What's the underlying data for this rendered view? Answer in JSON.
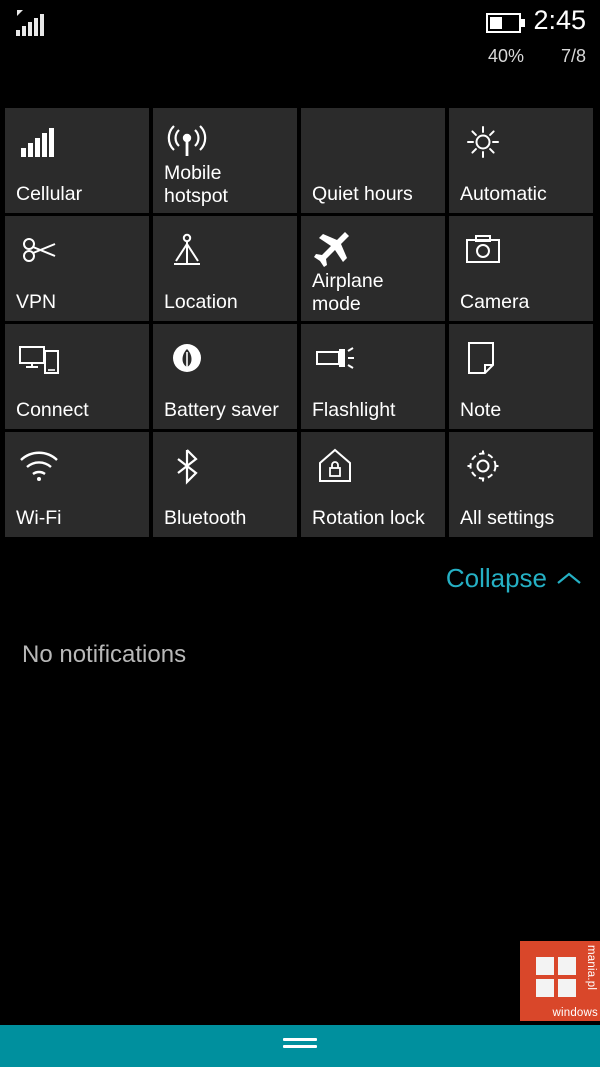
{
  "status_bar": {
    "signal_icon": "cellular-signal-icon",
    "signal_bars": 5,
    "battery_icon": "battery-icon",
    "battery_level_fraction": 0.4,
    "clock": "2:45",
    "battery_percent": "40%",
    "date": "7/8"
  },
  "action_center": {
    "tiles": [
      {
        "label": "Cellular",
        "icon": "cellular-signal-icon"
      },
      {
        "label": "Mobile\nhotspot",
        "icon": "mobile-hotspot-icon",
        "two_line": true
      },
      {
        "label": "Quiet hours",
        "icon": "moon-icon"
      },
      {
        "label": "Automatic",
        "icon": "brightness-sun-icon"
      },
      {
        "label": "VPN",
        "icon": "vpn-key-icon"
      },
      {
        "label": "Location",
        "icon": "location-pin-icon"
      },
      {
        "label": "Airplane\nmode",
        "icon": "airplane-icon",
        "two_line": true
      },
      {
        "label": "Camera",
        "icon": "camera-icon"
      },
      {
        "label": "Connect",
        "icon": "connect-devices-icon"
      },
      {
        "label": "Battery saver",
        "icon": "battery-saver-leaf-icon"
      },
      {
        "label": "Flashlight",
        "icon": "flashlight-icon"
      },
      {
        "label": "Note",
        "icon": "note-page-icon"
      },
      {
        "label": "Wi-Fi",
        "icon": "wifi-icon"
      },
      {
        "label": "Bluetooth",
        "icon": "bluetooth-icon"
      },
      {
        "label": "Rotation lock",
        "icon": "rotation-lock-icon"
      },
      {
        "label": "All settings",
        "icon": "gear-icon"
      }
    ],
    "collapse_label": "Collapse",
    "collapse_icon": "chevron-up-icon"
  },
  "notifications": {
    "empty_text": "No notifications"
  },
  "watermark": {
    "text": "windows",
    "text_vertical": "mania.pl",
    "icon": "windows-logo-icon",
    "color": "#d9472a"
  },
  "nav_bar": {
    "color": "#00909e",
    "handle_icon": "drag-handle-icon"
  },
  "colors": {
    "tile_background": "#2b2b2b",
    "accent": "#25b0c4",
    "page_background": "#000000",
    "muted_text": "#b8b8b8"
  }
}
